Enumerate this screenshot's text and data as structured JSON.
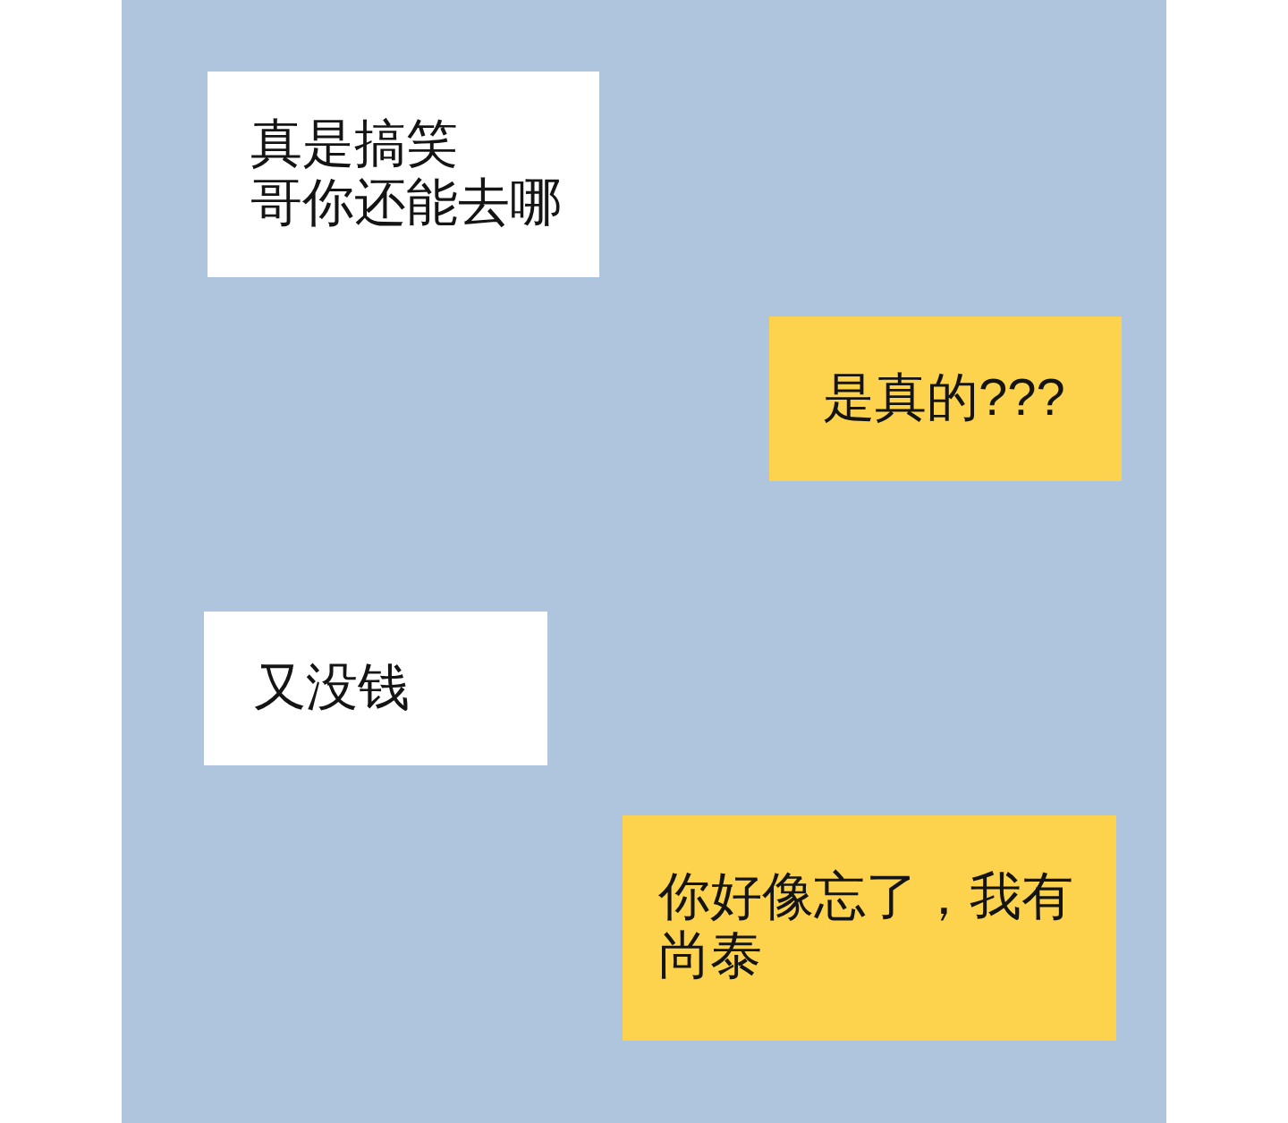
{
  "messages": [
    {
      "kind": "received",
      "lines": [
        "真是搞笑",
        "哥你还能去哪"
      ]
    },
    {
      "kind": "sent",
      "lines": [
        "是真的???"
      ]
    },
    {
      "kind": "received",
      "lines": [
        "又没钱"
      ]
    },
    {
      "kind": "sent",
      "lines": [
        "你好像忘了，我有尚泰"
      ]
    }
  ]
}
